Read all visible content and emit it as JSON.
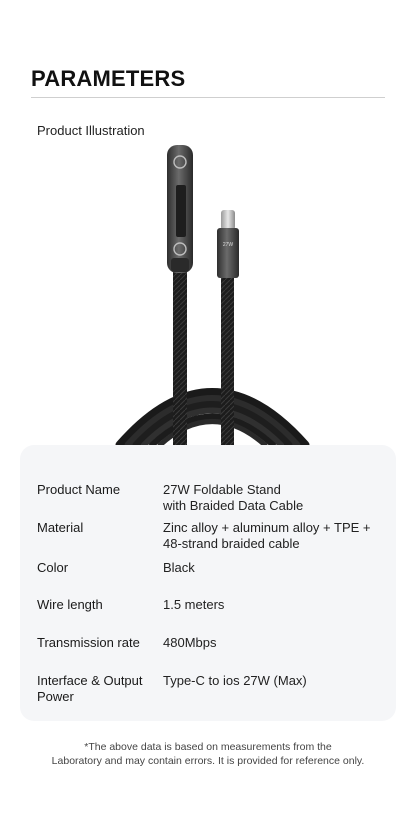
{
  "header": {
    "title": "PARAMETERS"
  },
  "section": {
    "illustration_label": "Product Illustration"
  },
  "product": {
    "plug_marking": "27W"
  },
  "specs": [
    {
      "label": "Product Name",
      "value_lines": [
        "27W Foldable Stand",
        "with Braided Data Cable"
      ]
    },
    {
      "label": "Material",
      "value_lines": [
        "Zinc alloy + aluminum alloy + TPE +",
        "48-strand braided cable"
      ]
    },
    {
      "label": "Color",
      "value_lines": [
        "Black"
      ]
    },
    {
      "label": "Wire length",
      "value_lines": [
        "1.5 meters"
      ]
    },
    {
      "label": "Transmission rate",
      "value_lines": [
        "480Mbps"
      ]
    },
    {
      "label_lines": [
        "Interface & Output",
        "Power"
      ],
      "value_lines": [
        "Type-C to ios 27W (Max)"
      ]
    }
  ],
  "footnote": {
    "line1": "*The above data is based on measurements from the",
    "line2": "Laboratory and may contain errors. It is provided for reference only."
  }
}
